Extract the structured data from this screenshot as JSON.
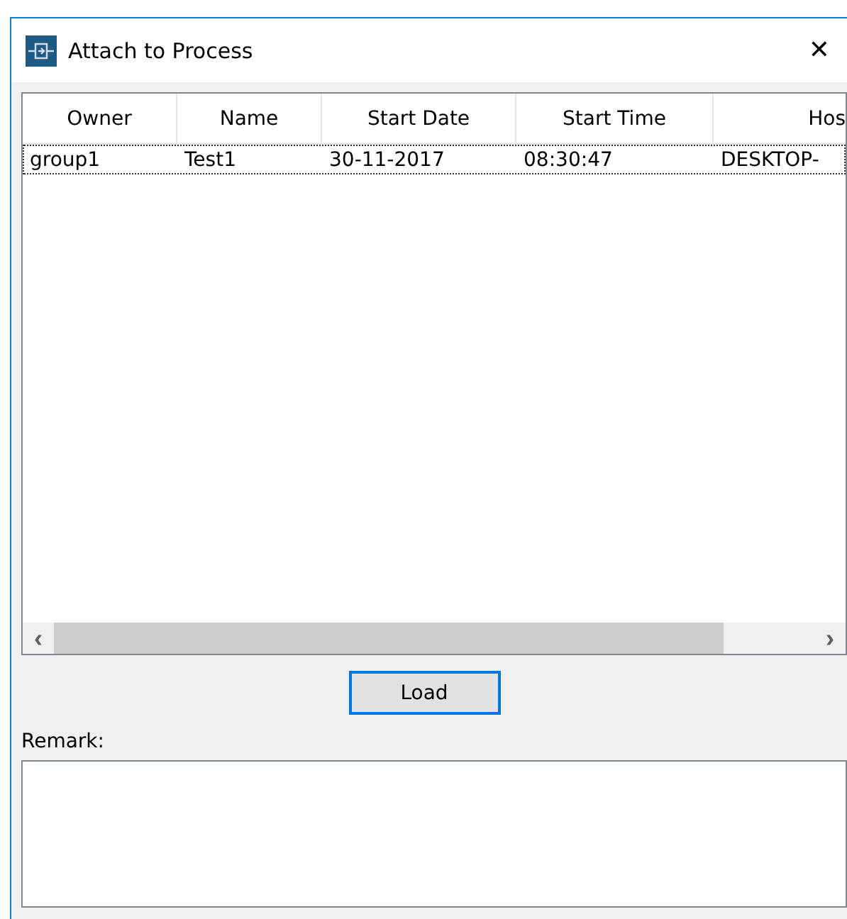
{
  "window": {
    "title": "Attach to Process",
    "close": "✕"
  },
  "table": {
    "columns": [
      "Owner",
      "Name",
      "Start Date",
      "Start Time",
      "Hos"
    ],
    "rows": [
      {
        "cells": [
          "group1",
          "Test1",
          "30-11-2017",
          "08:30:47",
          "DESKTOP-"
        ],
        "selected": true
      }
    ],
    "scrollbar": {
      "left": "‹",
      "right": "›"
    }
  },
  "load_button": "Load",
  "remark": {
    "label": "Remark:"
  }
}
